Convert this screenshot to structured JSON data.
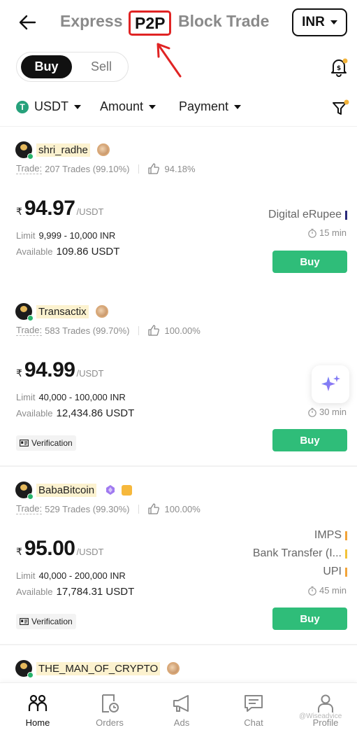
{
  "header": {
    "tabs": [
      "Express",
      "P2P",
      "Block Trade"
    ],
    "currency": "INR"
  },
  "side_toggle": {
    "buy": "Buy",
    "sell": "Sell"
  },
  "filters": {
    "coin": "USDT",
    "amount": "Amount",
    "payment": "Payment"
  },
  "labels": {
    "trade": "Trade:",
    "limit": "Limit",
    "available": "Available",
    "unit": "/USDT",
    "rupee": "₹",
    "buy_button": "Buy",
    "verification": "Verification"
  },
  "offers": [
    {
      "name": "shri_radhe",
      "trades": "207 Trades (99.10%)",
      "positive": "94.18%",
      "price": "94.97",
      "limit": "9,999 - 10,000 INR",
      "available": "109.86 USDT",
      "payments": [
        {
          "name": "Digital eRupee",
          "color": "#2a2a7a"
        }
      ],
      "time": "15 min"
    },
    {
      "name": "Transactix",
      "trades": "583 Trades (99.70%)",
      "positive": "100.00%",
      "price": "94.99",
      "limit": "40,000 - 100,000 INR",
      "available": "12,434.86 USDT",
      "payments": [],
      "time": "30 min"
    },
    {
      "name": "BabaBitcoin",
      "trades": "529 Trades (99.30%)",
      "positive": "100.00%",
      "price": "95.00",
      "limit": "40,000 - 200,000 INR",
      "available": "17,784.31 USDT",
      "payments": [
        {
          "name": "IMPS",
          "color": "#f2a43a"
        },
        {
          "name": "Bank Transfer (I...",
          "color": "#f2c23a"
        },
        {
          "name": "UPI",
          "color": "#f2a43a"
        }
      ],
      "time": "45 min"
    },
    {
      "name": "THE_MAN_OF_CRYPTO"
    }
  ],
  "bottom_nav": [
    "Home",
    "Orders",
    "Ads",
    "Chat",
    "Profile"
  ],
  "watermark": "@Wiseadvice",
  "colors": {
    "accent_green": "#2fbd79",
    "highlight_red": "#e02424",
    "name_highlight": "#fcf2cf"
  }
}
